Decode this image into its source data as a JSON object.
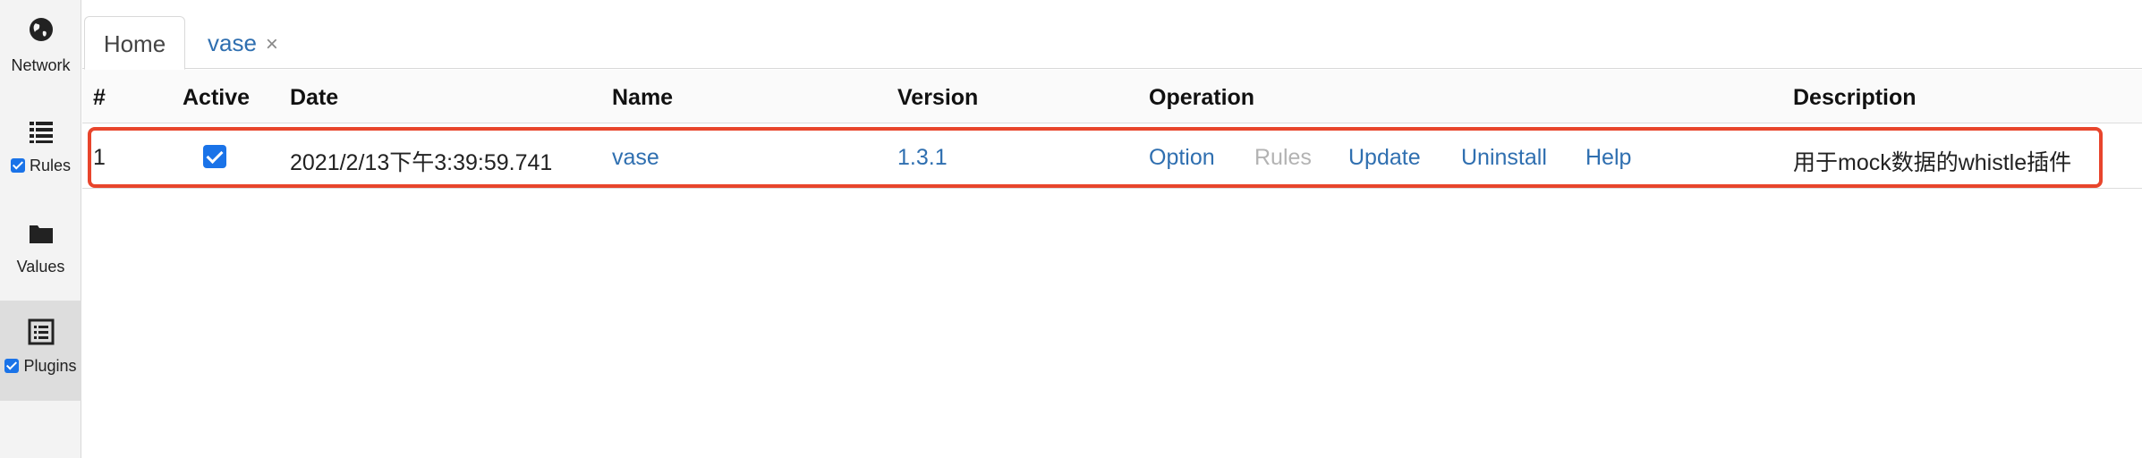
{
  "sidebar": {
    "items": [
      {
        "label": "Network",
        "icon": "globe-icon",
        "checked": null
      },
      {
        "label": "Rules",
        "icon": "list-icon",
        "checked": true
      },
      {
        "label": "Values",
        "icon": "folder-icon",
        "checked": null
      },
      {
        "label": "Plugins",
        "icon": "plugin-list-icon",
        "checked": true
      }
    ]
  },
  "tabs": {
    "home": "Home",
    "plugin": "vase",
    "close": "×"
  },
  "table": {
    "headers": {
      "index": "#",
      "active": "Active",
      "date": "Date",
      "name": "Name",
      "version": "Version",
      "operation": "Operation",
      "description": "Description"
    },
    "rows": [
      {
        "index": "1",
        "active": true,
        "date": "2021/2/13下午3:39:59.741",
        "name": "vase",
        "version": "1.3.1",
        "operations": {
          "option": "Option",
          "rules": "Rules",
          "update": "Update",
          "uninstall": "Uninstall",
          "help": "Help"
        },
        "description": "用于mock数据的whistle插件"
      }
    ]
  },
  "colors": {
    "link": "#2f6fb0",
    "disabled": "#b3b3b3",
    "highlight": "#e8452c",
    "checkbox": "#1a73e8"
  }
}
